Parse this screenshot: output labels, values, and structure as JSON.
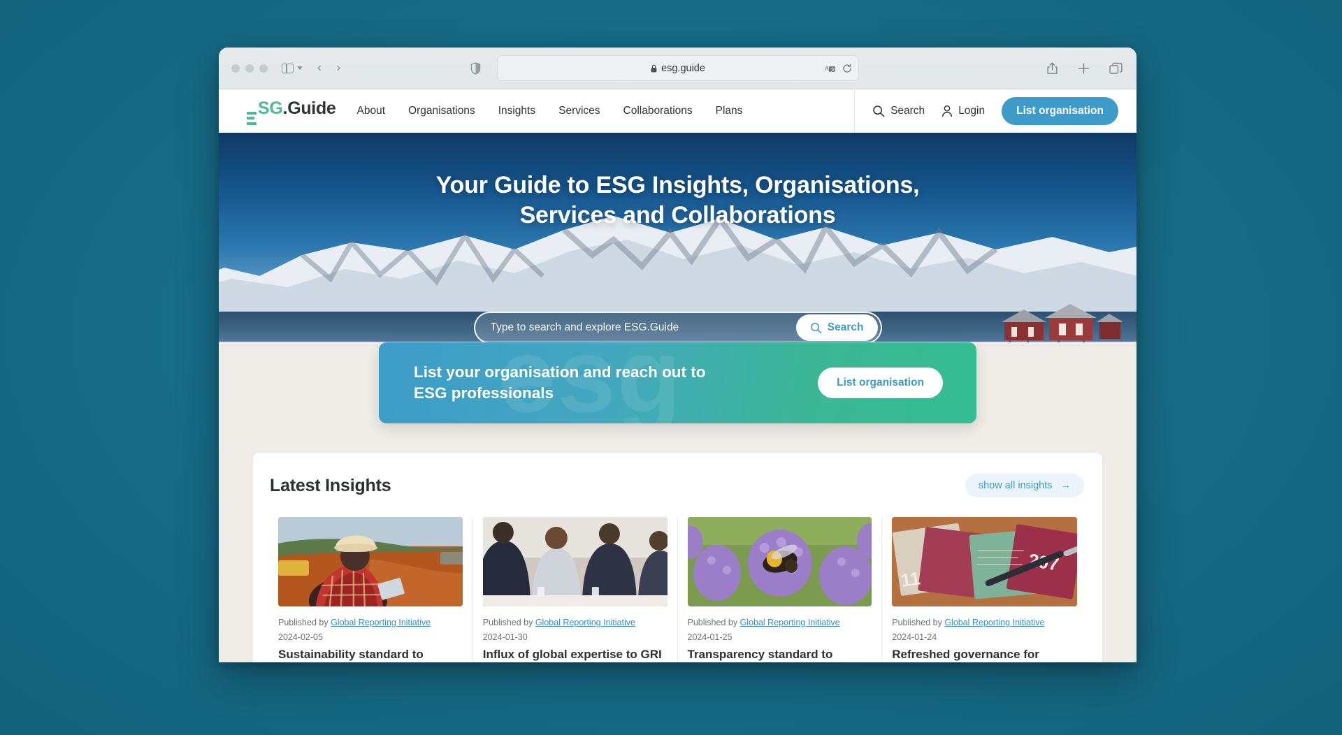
{
  "browser": {
    "url": "esg.guide",
    "lock_icon": "lock-icon",
    "traffic_lights": [
      "close",
      "minimize",
      "zoom"
    ],
    "back_label": "‹",
    "forward_label": "›",
    "icons": {
      "sidebar": "sidebar-toggle-icon",
      "shield": "privacy-shield-icon",
      "translate": "translate-icon",
      "reload": "reload-icon",
      "share": "share-icon",
      "new_tab": "plus-icon",
      "tab_overview": "tab-overview-icon"
    }
  },
  "site_nav": {
    "logo": {
      "mark": "ESG",
      "dot": ".",
      "word": "Guide"
    },
    "links": [
      {
        "label": "About"
      },
      {
        "label": "Organisations"
      },
      {
        "label": "Insights"
      },
      {
        "label": "Services"
      },
      {
        "label": "Collaborations"
      },
      {
        "label": "Plans"
      }
    ],
    "search_label": "Search",
    "login_label": "Login",
    "list_org_label": "List organisation"
  },
  "hero": {
    "title": "Your Guide to ESG Insights, Organisations, Services and Collaborations",
    "search_placeholder": "Type to search and explore ESG.Guide",
    "search_value": "",
    "search_button": "Search",
    "background_alt": "snow-covered fjord mountains under deep blue sky"
  },
  "cta": {
    "heading": "List your organisation and reach out to ESG professionals",
    "button": "List organisation",
    "watermark": "esg"
  },
  "insights": {
    "title": "Latest Insights",
    "show_all_label": "show all insights",
    "show_all_arrow": "→",
    "published_by_prefix": "Published by",
    "cards": [
      {
        "publisher": "Global Reporting Initiative",
        "date": "2024-02-05",
        "title": "Sustainability standard to accelerate accountability in",
        "image_alt": "worker wearing hard hat holding tablet at a mining site"
      },
      {
        "publisher": "Global Reporting Initiative",
        "date": "2024-01-30",
        "title": "Influx of global expertise to GRI Supervisory Board",
        "image_alt": "business people standing and talking in a meeting room"
      },
      {
        "publisher": "Global Reporting Initiative",
        "date": "2024-01-25",
        "title": "Transparency standard to inform global response to",
        "image_alt": "bumblebee on a purple phacelia flower"
      },
      {
        "publisher": "Global Reporting Initiative",
        "date": "2024-01-24",
        "title": "Refreshed governance for global sustainability standard",
        "image_alt": "colourful paper notes and pen on a desk"
      }
    ]
  },
  "colors": {
    "desktop_backdrop": "#1a7a96",
    "brand_green": "#4cbb93",
    "brand_blue": "#3c9bc9",
    "link_blue": "#3c8dc4",
    "page_bg": "#efece7",
    "text_dark": "#2b3033"
  }
}
